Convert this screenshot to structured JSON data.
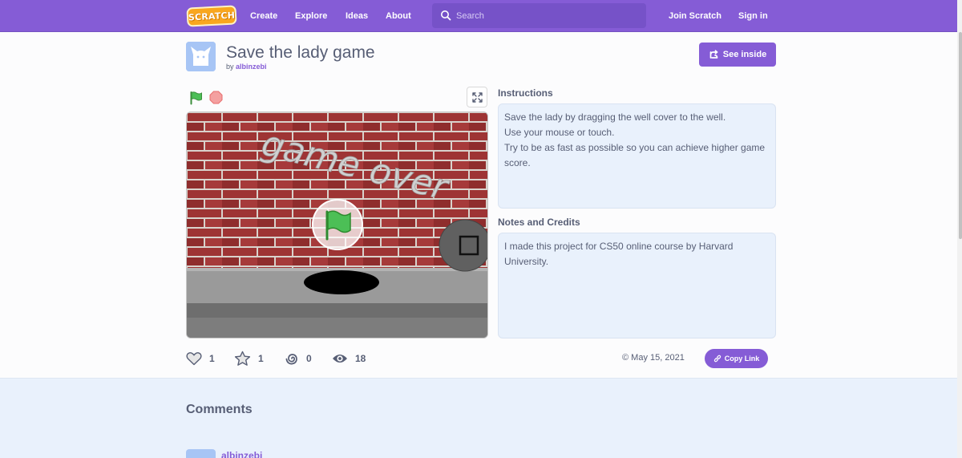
{
  "colors": {
    "brand": "#855cd6",
    "nav_bg": "#855cd6",
    "info_bg": "#e9f1fc",
    "text": "#575e75"
  },
  "nav": {
    "logo": "SCRATCH",
    "create": "Create",
    "explore": "Explore",
    "ideas": "Ideas",
    "about": "About",
    "search_placeholder": "Search",
    "search_icon": "search-icon",
    "join": "Join Scratch",
    "signin": "Sign in"
  },
  "project": {
    "title": "Save the lady game",
    "by_prefix": "by",
    "author": "albinzebi",
    "see_inside": "See inside",
    "see_inside_icon": "remix-icon"
  },
  "player": {
    "green_flag_icon": "green-flag-icon",
    "stop_icon": "stop-icon",
    "fullscreen_icon": "fullscreen-icon",
    "stage_text": "game over",
    "stage_play_icon": "green-flag-icon"
  },
  "instructions": {
    "label": "Instructions",
    "text": "Save the lady by dragging the well cover to the well.\nUse your mouse or touch.\nTry to be as fast as possible so you can achieve higher game score."
  },
  "notes": {
    "label": "Notes and Credits",
    "text": "I made this project for CS50 online course by Harvard University."
  },
  "stats": {
    "loves": "1",
    "favorites": "1",
    "remixes": "0",
    "views": "18"
  },
  "date": "© May 15, 2021",
  "copy_link": "Copy Link",
  "comments": {
    "title": "Comments",
    "first_user": "albinzebi"
  }
}
